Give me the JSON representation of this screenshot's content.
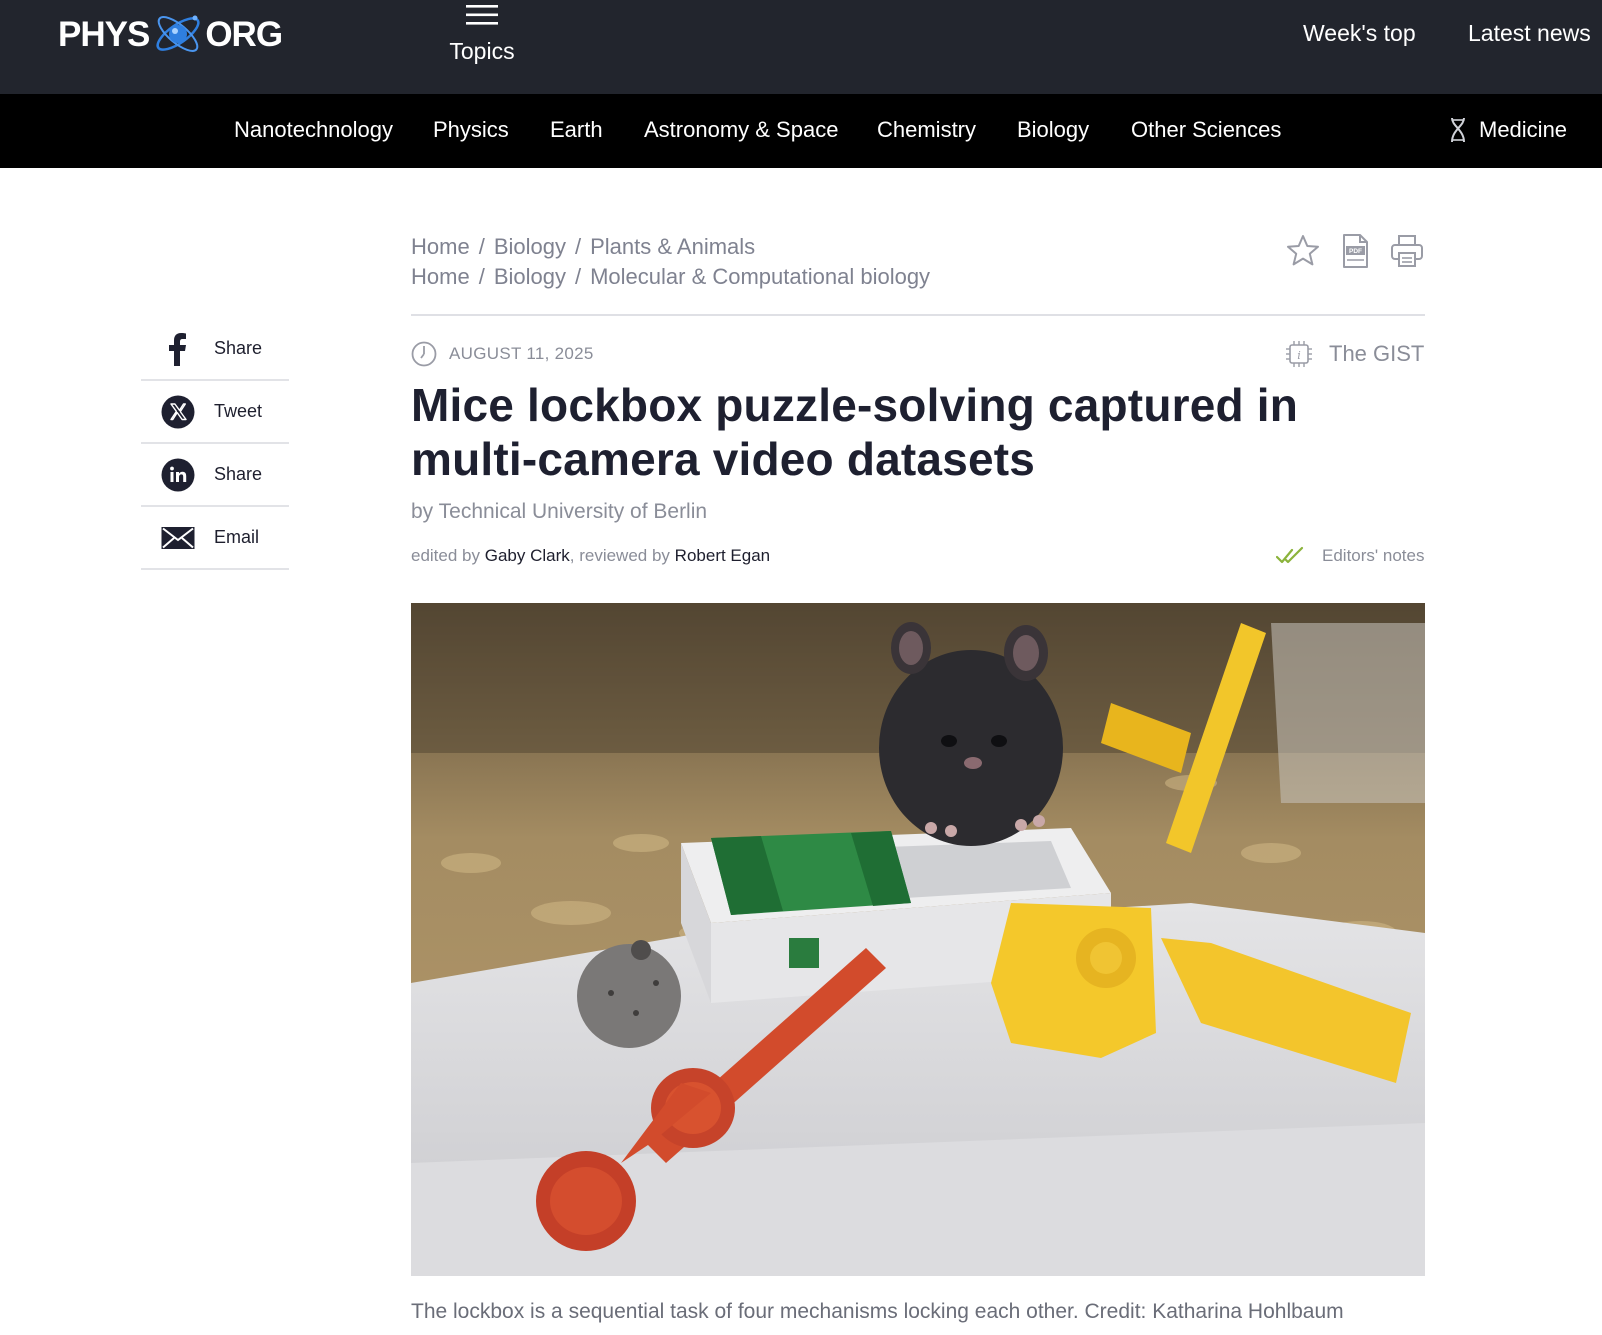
{
  "header": {
    "logo_left": "PHYS",
    "logo_right": "ORG",
    "topics_label": "Topics",
    "weeks_top": "Week's top",
    "latest_news": "Latest news"
  },
  "categories": [
    "Nanotechnology",
    "Physics",
    "Earth",
    "Astronomy & Space",
    "Chemistry",
    "Biology",
    "Other Sciences",
    "Medicine"
  ],
  "share": [
    {
      "label": "Share",
      "icon": "facebook-icon"
    },
    {
      "label": "Tweet",
      "icon": "x-icon"
    },
    {
      "label": "Share",
      "icon": "linkedin-icon"
    },
    {
      "label": "Email",
      "icon": "email-icon"
    }
  ],
  "breadcrumbs": [
    [
      "Home",
      "Biology",
      "Plants & Animals"
    ],
    [
      "Home",
      "Biology",
      "Molecular & Computational biology"
    ]
  ],
  "breadcrumb_separator": "/",
  "tools": [
    "star-icon",
    "pdf-icon",
    "print-icon"
  ],
  "article": {
    "date": "AUGUST 11, 2025",
    "gist": "The GIST",
    "title": "Mice lockbox puzzle-solving captured in multi-camera video datasets",
    "byline": "by Technical University of Berlin",
    "edited_prefix": "edited by",
    "editor": "Gaby Clark",
    "reviewed_prefix": ", reviewed by",
    "reviewer": "Robert Egan",
    "editors_notes": "Editors' notes",
    "caption": "The lockbox is a sequential task of four mechanisms locking each other. Credit: Katharina Hohlbaum"
  },
  "colors": {
    "header_bg": "#22252d",
    "nav_bg": "#000000",
    "logo_accent": "#2f7fe0",
    "check_green": "#8bb33b",
    "muted_text": "#8a8d98"
  }
}
